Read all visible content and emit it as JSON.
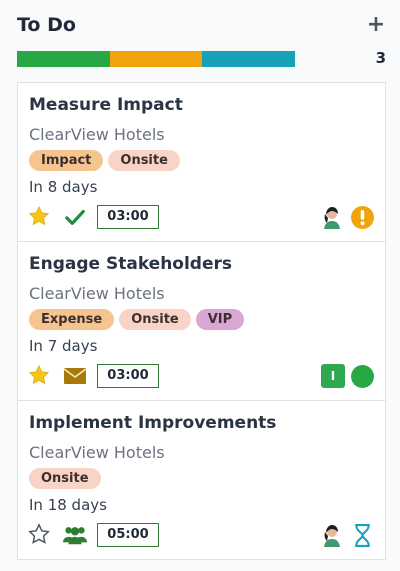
{
  "column": {
    "title": "To Do",
    "count": "3",
    "progress": [
      {
        "color": "#28a745",
        "fraction": 0.333
      },
      {
        "color": "#f0a30a",
        "fraction": 0.333
      },
      {
        "color": "#17a2b8",
        "fraction": 0.334
      }
    ]
  },
  "cards": [
    {
      "title": "Measure Impact",
      "company": "ClearView Hotels",
      "tags": [
        {
          "label": "Impact",
          "color": "#f6c48f"
        },
        {
          "label": "Onsite",
          "color": "#f8d3c6"
        }
      ],
      "deadline": "In 8 days",
      "starred": true,
      "activity_icon": "check-icon",
      "time": "03:00",
      "status_icon": "warning-icon"
    },
    {
      "title": "Engage Stakeholders",
      "company": "ClearView Hotels",
      "tags": [
        {
          "label": "Expense",
          "color": "#f6c48f"
        },
        {
          "label": "Onsite",
          "color": "#f8d3c6"
        },
        {
          "label": "VIP",
          "color": "#d9a7d3"
        }
      ],
      "deadline": "In 7 days",
      "starred": true,
      "activity_icon": "envelope-icon",
      "time": "03:00",
      "avatar_letter": "I",
      "status_icon": "green-dot-icon"
    },
    {
      "title": "Implement Improvements",
      "company": "ClearView Hotels",
      "tags": [
        {
          "label": "Onsite",
          "color": "#f8d3c6"
        }
      ],
      "deadline": "In 18 days",
      "starred": false,
      "activity_icon": "users-icon",
      "time": "05:00",
      "status_icon": "hourglass-icon"
    }
  ]
}
